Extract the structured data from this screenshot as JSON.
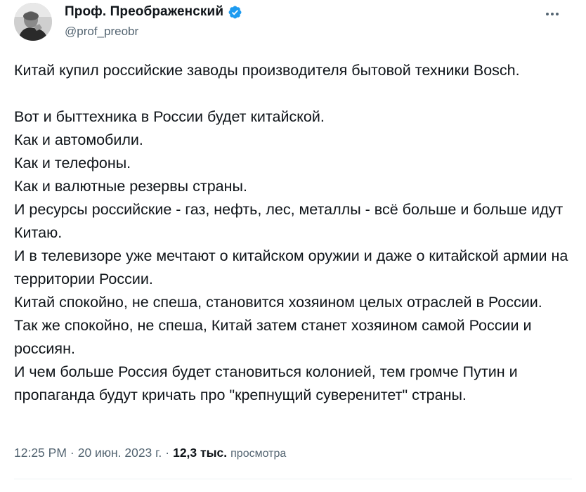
{
  "author": {
    "display_name": "Проф. Преображенский",
    "handle": "@prof_preobr",
    "verified": true
  },
  "post": {
    "first_line": "Китай купил российские заводы производителя бытовой техники Bosch.",
    "lines": [
      "Вот и быттехника в России будет китайской.",
      "Как и автомобили.",
      "Как и телефоны.",
      "Как и валютные резервы страны.",
      "И ресурсы российские - газ, нефть, лес, металлы - всё больше и больше идут Китаю.",
      "И в телевизоре уже мечтают о китайском оружии и даже о китайской армии на территории России.",
      "Китай спокойно, не спеша, становится хозяином целых отраслей в России.",
      "Так же спокойно, не спеша, Китай затем станет хозяином самой России и россиян.",
      "И чем больше Россия будет становиться колонией, тем громче Путин и пропаганда будут кричать про \"крепнущий суверенитет\" страны."
    ]
  },
  "meta": {
    "time": "12:25 PM",
    "separator": "·",
    "date": "20 июн. 2023 г.",
    "views_count": "12,3 тыс.",
    "views_label": "просмотра"
  },
  "colors": {
    "text": "#0f1419",
    "secondary": "#536471",
    "verified": "#1d9bf0",
    "divider": "#eff3f4"
  },
  "icons": {
    "verified": "verified-badge-icon",
    "more": "more-horizontal-icon",
    "avatar": "user-avatar"
  }
}
